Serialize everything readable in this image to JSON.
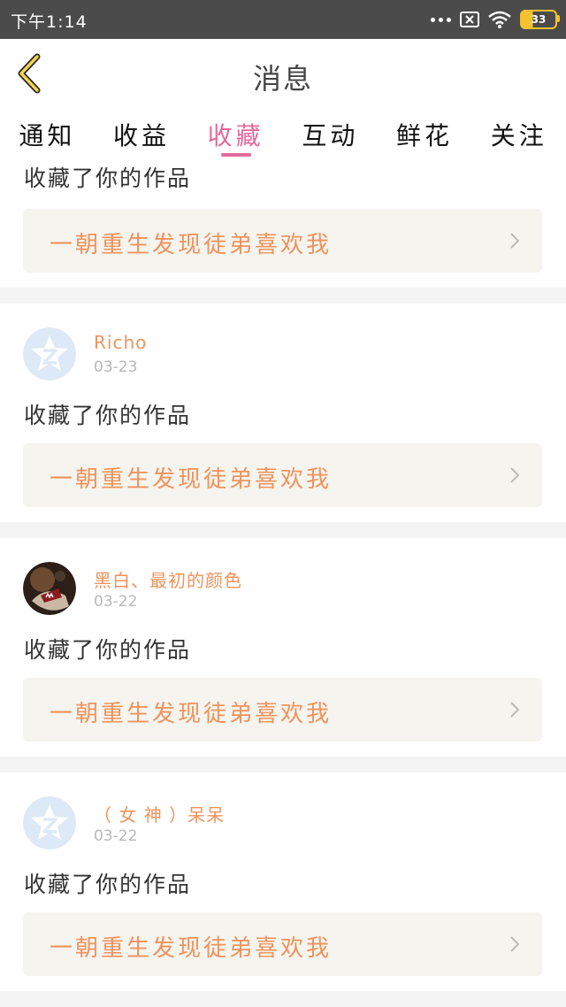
{
  "status_bar": {
    "time": "下午1:14",
    "battery": "33"
  },
  "header": {
    "title": "消息"
  },
  "tabs": [
    {
      "label": "通知",
      "active": false
    },
    {
      "label": "收益",
      "active": false
    },
    {
      "label": "收藏",
      "active": true
    },
    {
      "label": "互动",
      "active": false
    },
    {
      "label": "鲜花",
      "active": false
    },
    {
      "label": "关注",
      "active": false
    }
  ],
  "colors": {
    "accent": "#e46a9c",
    "username": "#f0935c",
    "link_bg": "#f5f4ef"
  },
  "items": [
    {
      "action": "收藏了你的作品",
      "work_title": "一朝重生发现徒弟喜欢我"
    },
    {
      "username": "Richo",
      "date": "03-23",
      "avatar": "default-avatar-icon",
      "action": "收藏了你的作品",
      "work_title": "一朝重生发现徒弟喜欢我"
    },
    {
      "username": "黑白、最初的颜色",
      "date": "03-22",
      "avatar": "photo-avatar",
      "action": "收藏了你的作品",
      "work_title": "一朝重生发现徒弟喜欢我"
    },
    {
      "username": "（ 女 神 ）呆呆",
      "date": "03-22",
      "avatar": "default-avatar-icon",
      "action": "收藏了你的作品",
      "work_title": "一朝重生发现徒弟喜欢我"
    }
  ]
}
